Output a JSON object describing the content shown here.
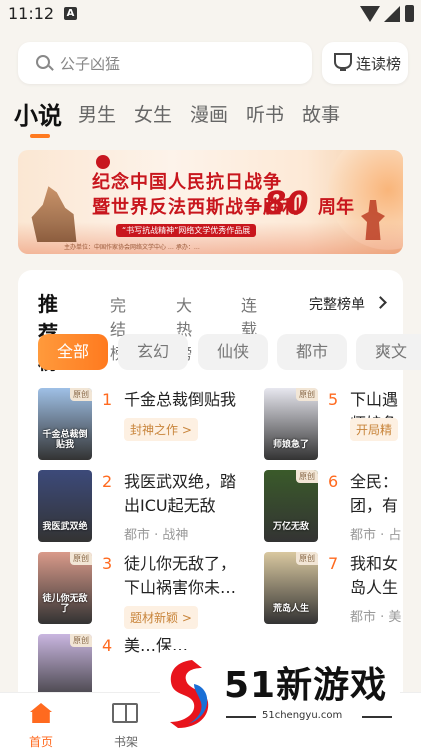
{
  "status_bar": {
    "time": "11:12",
    "notification_icon_letter": "A"
  },
  "search": {
    "placeholder": "公子凶猛",
    "rank_button_label": "连读榜"
  },
  "category_tabs": [
    "小说",
    "男生",
    "女生",
    "漫画",
    "听书",
    "故事"
  ],
  "active_category": "小说",
  "banner": {
    "line1": "纪念中国人民抗日战争",
    "line2": "暨世界反法西斯战争胜利",
    "number": "80",
    "suffix": "周年",
    "slogan": "“书写抗战精神”网络文学优秀作品展",
    "organizer": "主办单位：中国作家协会网络文学中心 … 承办：…"
  },
  "ranking": {
    "tabs": [
      "推荐榜",
      "完结榜",
      "大热榜",
      "连载榜"
    ],
    "full_rank_label": "完整榜单",
    "genre_chips": [
      "全部",
      "玄幻",
      "仙侠",
      "都市",
      "爽文"
    ],
    "books_left": [
      {
        "rank": "1",
        "title": "千金总裁倒贴我",
        "pill": "封神之作 >",
        "meta": "",
        "cover_tag": "原创",
        "cover_text": "千金总裁倒贴我",
        "cover_color": "#9fc0e6"
      },
      {
        "rank": "2",
        "title": "我医武双绝，踏出ICU起无敌",
        "pill": "",
        "meta": "都市 · 战神",
        "cover_tag": "",
        "cover_text": "我医武双绝",
        "cover_color": "#3c4a7a"
      },
      {
        "rank": "3",
        "title": "徒儿你无敌了，下山祸害你未…",
        "pill": "题材新颖 >",
        "meta": "",
        "cover_tag": "原创",
        "cover_text": "徒儿你无敌了",
        "cover_color": "#d99a8a"
      },
      {
        "rank": "4",
        "title": "美…保…",
        "pill": "",
        "meta": "",
        "cover_tag": "原创",
        "cover_text": "",
        "cover_color": "#c9b6e0"
      }
    ],
    "books_right": [
      {
        "rank": "5",
        "title": "下山遇师娘急",
        "pill": "开局精",
        "meta": "",
        "cover_tag": "原创",
        "cover_text": "师娘急了",
        "cover_color": "#e7e7ef"
      },
      {
        "rank": "6",
        "title": "全民：团，有",
        "pill": "",
        "meta": "都市 · 占",
        "cover_tag": "原创",
        "cover_text": "万亿无敌",
        "cover_color": "#3a5a2a"
      },
      {
        "rank": "7",
        "title": "我和女岛人生",
        "pill": "",
        "meta": "都市 · 美",
        "cover_tag": "原创",
        "cover_text": "荒岛人生",
        "cover_color": "#d9c8a0"
      }
    ]
  },
  "bottom_nav": {
    "home": "首页",
    "shelf": "书架"
  },
  "watermark": {
    "brand": "51新游戏",
    "site": "51chengyu.com"
  },
  "colors": {
    "accent": "#ff7a1f",
    "banner_red": "#c8161d"
  }
}
